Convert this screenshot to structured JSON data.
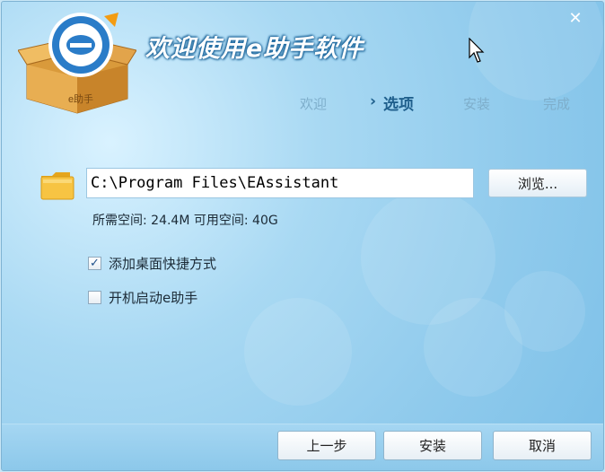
{
  "title": "欢迎使用e助手软件",
  "logo": {
    "badge_text": "e助手"
  },
  "close_glyph": "✕",
  "steps": [
    {
      "label": "欢迎",
      "active": false
    },
    {
      "label": "选项",
      "active": true
    },
    {
      "label": "安装",
      "active": false
    },
    {
      "label": "完成",
      "active": false
    }
  ],
  "install_path": {
    "value": "C:\\Program Files\\EAssistant",
    "browse_label": "浏览..."
  },
  "space_info": "所需空间: 24.4M  可用空间: 40G",
  "options": [
    {
      "label": "添加桌面快捷方式",
      "checked": true
    },
    {
      "label": "开机启动e助手",
      "checked": false
    }
  ],
  "buttons": {
    "back": "上一步",
    "install": "安装",
    "cancel": "取消"
  },
  "colors": {
    "accent": "#1f5f8c",
    "background": "#8fcaec",
    "title_outline": "#1a5d8f"
  }
}
